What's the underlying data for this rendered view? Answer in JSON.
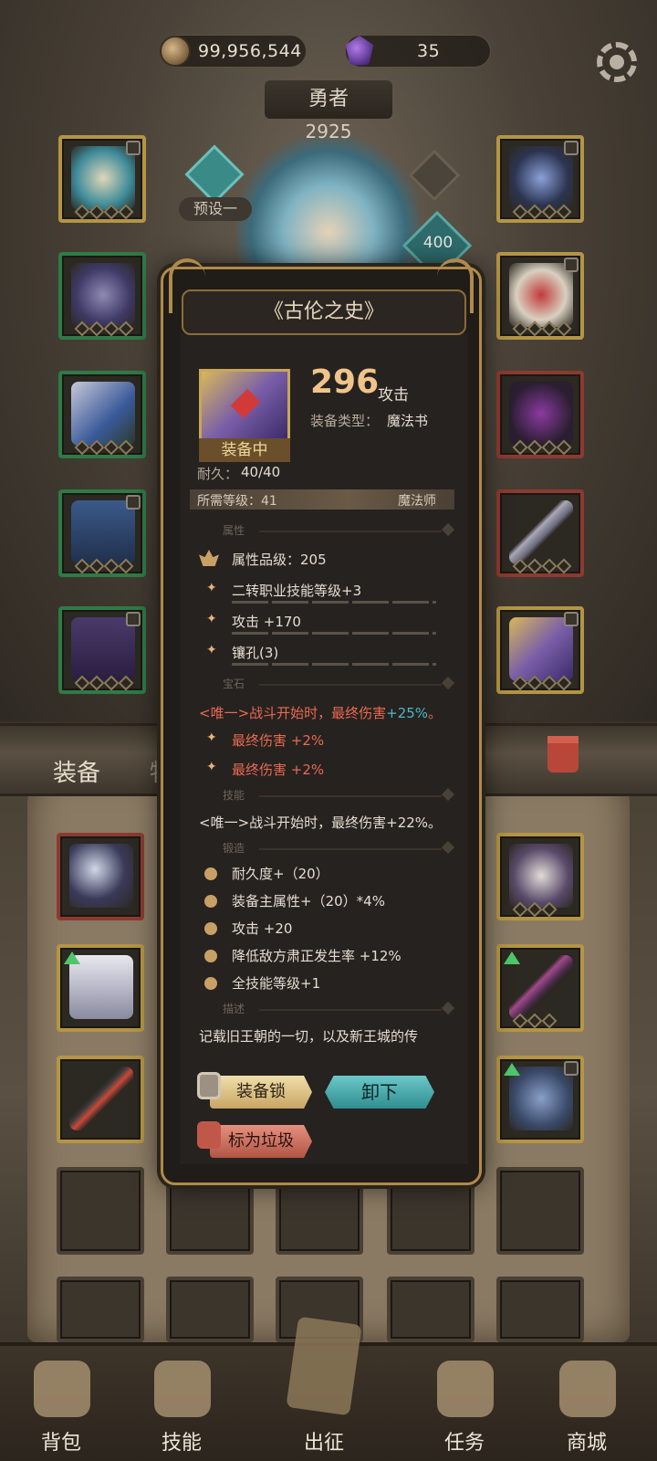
{
  "currency": {
    "coins": "99,956,544",
    "gems": "35"
  },
  "hero": {
    "name": "勇者",
    "power": "2925",
    "preset_label": "预设一",
    "level": "400"
  },
  "bag_tabs": {
    "equipment": "装备",
    "items": "物品"
  },
  "item": {
    "name": "《古伦之史》",
    "attack_value": "296",
    "attack_label": "攻击",
    "type_label": "装备类型：",
    "type_value": "魔法书",
    "equipped": "装备中",
    "durability_label": "耐久：",
    "durability_value": "40/40",
    "required_level": "所需等级：41",
    "class": "魔法师",
    "sections": {
      "attributes": "属性",
      "gems": "宝石",
      "skills": "技能",
      "forging": "锻造",
      "description": "描述"
    },
    "attribute_grade": "属性品级：205",
    "attributes": [
      "二转职业技能等级+3",
      "攻击 +170",
      "镶孔(3)"
    ],
    "gem_unique_prefix": "<唯一>战斗开始时，最终伤害",
    "gem_unique_value": "+25%",
    "gem_unique_suffix": "。",
    "gem_lines": [
      "最终伤害 +2%",
      "最终伤害 +2%"
    ],
    "skill_line": "<唯一>战斗开始时，最终伤害+22%。",
    "forging_lines": [
      "耐久度+（20）",
      "装备主属性+（20）*4%",
      "攻击 +20",
      "降低敌方肃正发生率 +12%",
      "全技能等级+1"
    ],
    "description_text": "记载旧王朝的一切，以及新王城的传"
  },
  "buttons": {
    "lock": "装备锁",
    "unequip": "卸下",
    "mark_trash": "标为垃圾"
  },
  "bottom_nav": [
    "背包",
    "技能",
    "出征",
    "任务",
    "商城"
  ],
  "colors": {
    "accent_gold": "#b08a4a",
    "unique_red": "#ea6a50",
    "highlight_teal": "#4ab9c4"
  }
}
